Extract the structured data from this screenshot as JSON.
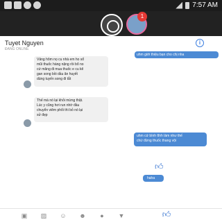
{
  "status_bar": {
    "left_icons": [
      "notification-icon",
      "notification-icon",
      "notification-icon",
      "notification-icon"
    ],
    "time": "7:57 AM"
  },
  "chat_heads": {
    "badge": "1"
  },
  "header": {
    "contact_name": "Tuyet Nguyen",
    "subtitle": "ĐANG ONLINE"
  },
  "messages": [
    {
      "side": "out",
      "text": "uhm giới thiệu bạn cho chị nha"
    },
    {
      "side": "in",
      "lines": [
        "Vâng hôm nọ cu nhà em ho sổ",
        "mũi thuốc hàng nặng rồi bổ no",
        "cứ măng đi mua thuốc e cu kẽ",
        "gan song bồi dầu ăn huyết",
        "dùng tuyến song đi tắt"
      ]
    },
    {
      "side": "in",
      "lines": [
        "Thế mà nó lại khỏi mừng thật.",
        "Lúc y cũng hơi run nhờ đầu",
        "chuyển viêm phổi thì bỏ nó lại",
        "sử đẹp"
      ]
    },
    {
      "side": "out",
      "lines": [
        "uhm cứ bình tĩnh làm như thế",
        "chứ đừng thuốc thang vội"
      ]
    },
    {
      "side": "out",
      "text": "haha"
    }
  ],
  "colors": {
    "accent": "#4c8ad4",
    "statusbar": "#1c1c1c",
    "incoming": "#f0f0f0"
  }
}
